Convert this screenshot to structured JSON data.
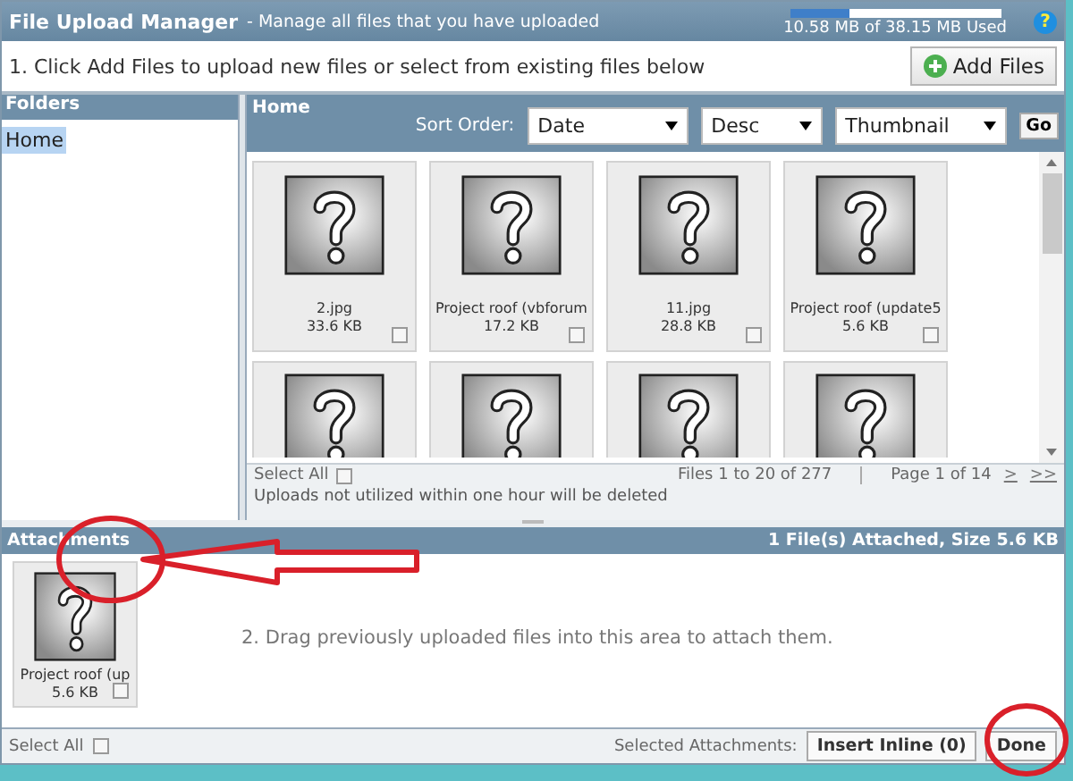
{
  "header": {
    "title": "File Upload Manager",
    "subtitle": "- Manage all files that you have uploaded",
    "quota": {
      "level": 0.28,
      "reading": "10.58 MB of 38.15 MB Used"
    },
    "help": "?"
  },
  "instruction": "1. Click Add Files to upload new files or select from existing files below",
  "add_button": "Add Files",
  "folders": {
    "title": "Folders",
    "items": [
      {
        "label": "Home",
        "selected": true
      }
    ]
  },
  "files": {
    "title": "Home",
    "sort_label": "Sort Order:",
    "selects": [
      "Date",
      "Desc",
      "Thumbnail"
    ],
    "go": "Go",
    "items": [
      {
        "kind": "full",
        "name": "2.jpg",
        "size": "33.6 KB",
        "checked": false
      },
      {
        "kind": "full",
        "name": "Project roof (vbforum",
        "size": "17.2 KB",
        "checked": false
      },
      {
        "kind": "full",
        "name": "11.jpg",
        "size": "28.8 KB",
        "checked": false
      },
      {
        "kind": "full",
        "name": "Project roof (update5",
        "size": "5.6 KB",
        "checked": false
      },
      {
        "kind": "cut"
      },
      {
        "kind": "cut"
      },
      {
        "kind": "cut"
      },
      {
        "kind": "cut"
      }
    ],
    "select_all": {
      "label": "Select All",
      "checked": false
    },
    "count": "Files 1 to 20 of 277",
    "page": "Page 1 of 14",
    "next": ">",
    "last": ">>",
    "notice": "Uploads not utilized within one hour will be deleted"
  },
  "attachments": {
    "title": "Attachments",
    "summary": "1 File(s) Attached, Size 5.6 KB",
    "items": [
      {
        "name": "Project roof (up",
        "size": "5.6 KB",
        "checked": false
      }
    ],
    "hint": "2. Drag previously uploaded files into this area to attach them.",
    "select_all": {
      "label": "Select All",
      "checked": false
    },
    "selected_label": "Selected Attachments:",
    "insert_button": "Insert Inline (0)",
    "done_button": "Done"
  }
}
